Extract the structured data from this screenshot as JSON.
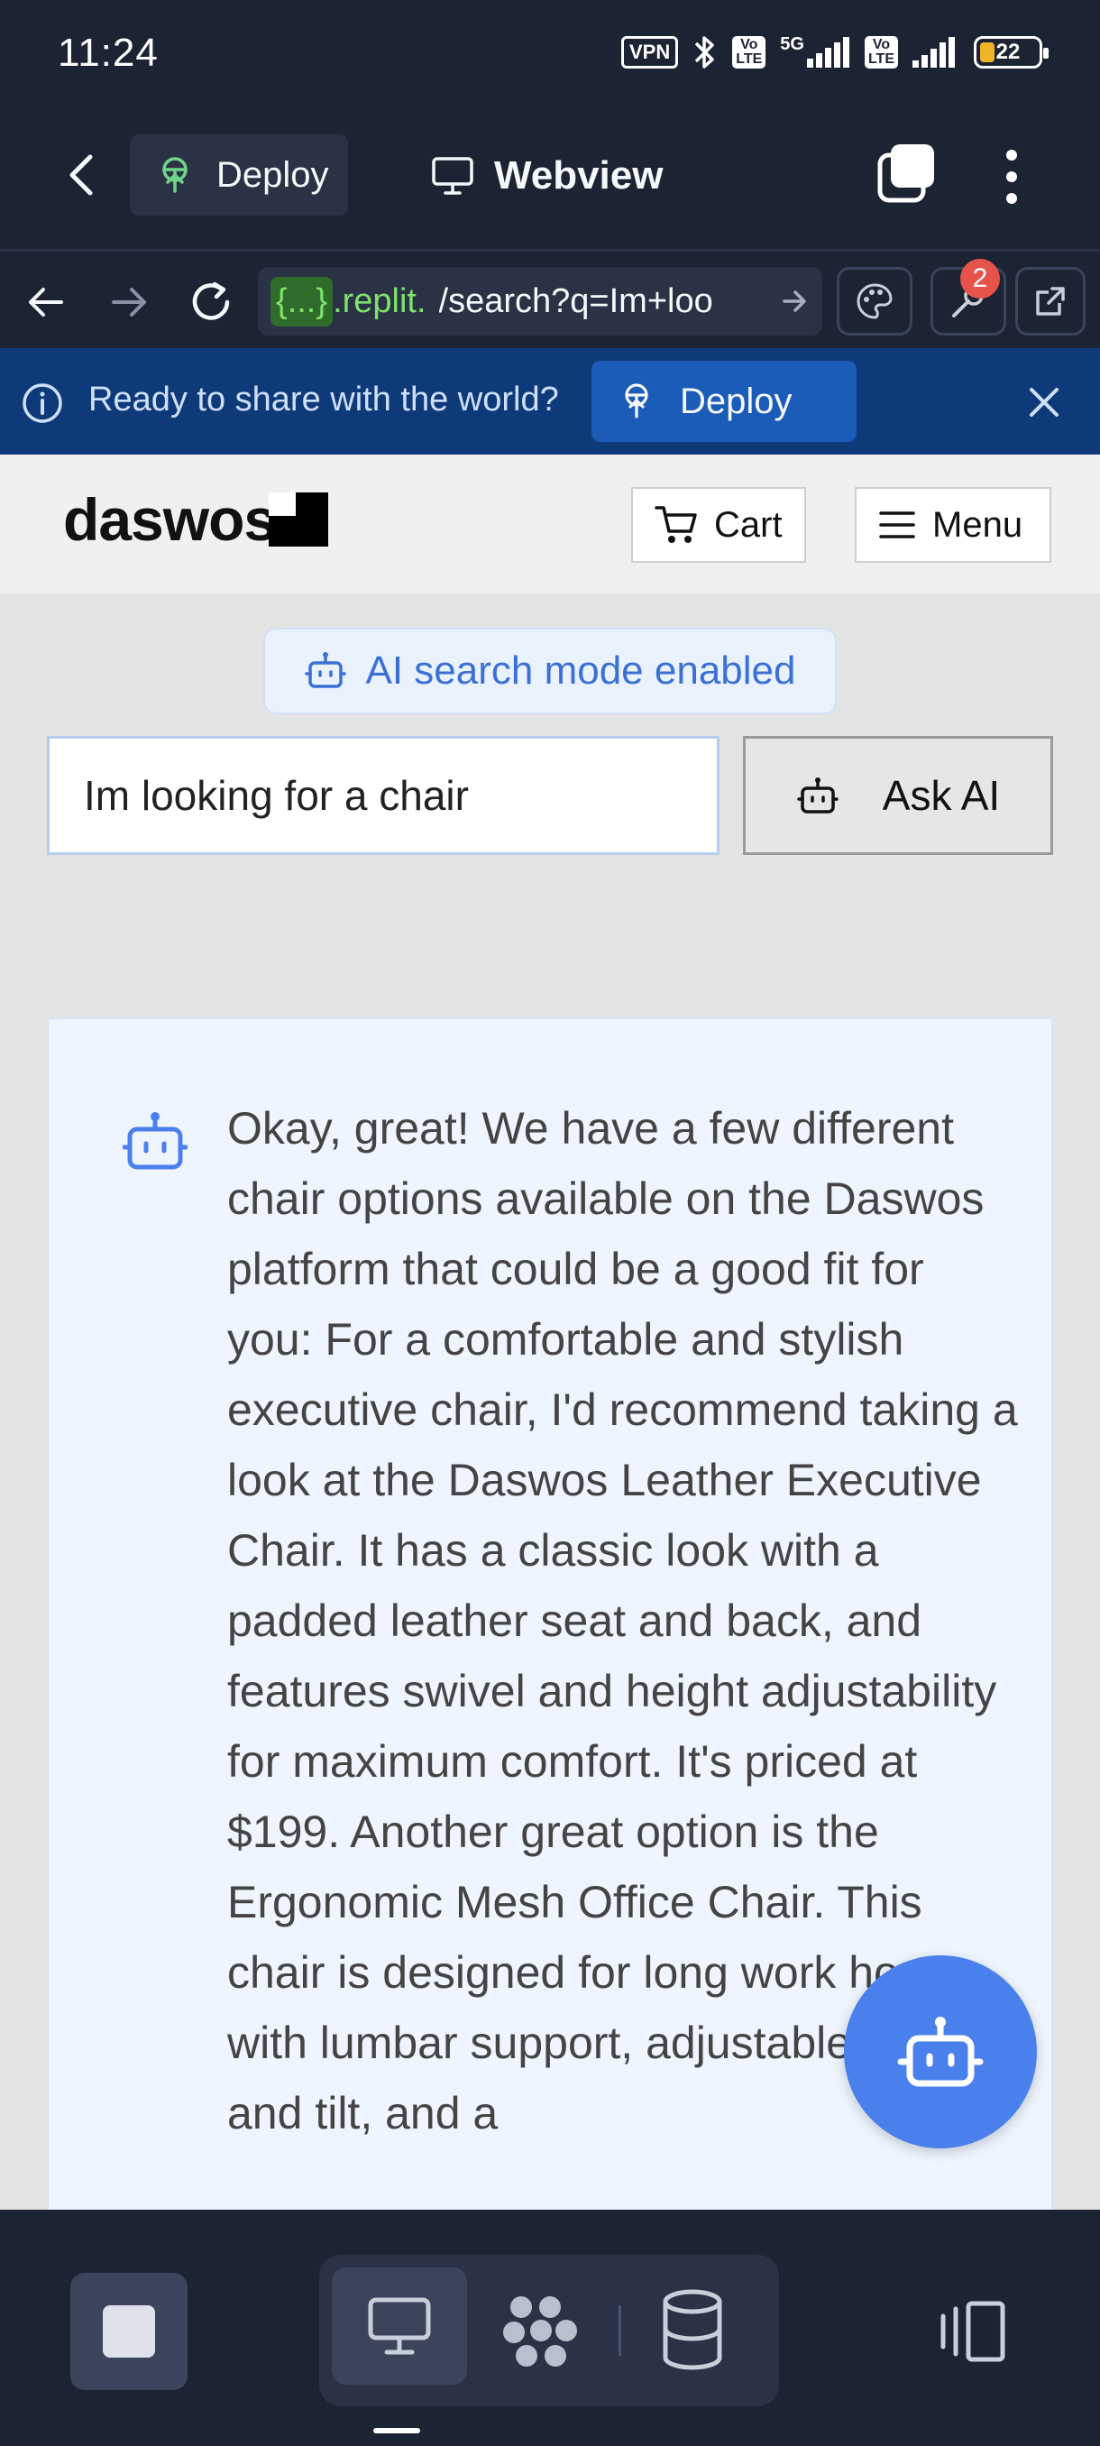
{
  "status_bar": {
    "time": "11:24",
    "vpn_label": "VPN",
    "signal_1": {
      "top": "Vo",
      "bottom": "LTE",
      "tech": "5G"
    },
    "signal_2": {
      "top": "Vo",
      "bottom": "LTE"
    },
    "battery_level": "22",
    "battery_color": "#f0b429"
  },
  "app_bar": {
    "deploy_label": "Deploy",
    "webview_title": "Webview"
  },
  "browser": {
    "url_host": "{...}",
    "url_host_rest": ".replit.",
    "url_path": "/search?q=Im+loo",
    "notification_count": "2"
  },
  "banner": {
    "text": "Ready to share with the world?",
    "deploy_label": "Deploy"
  },
  "site": {
    "logo_text": "daswos",
    "cart_label": "Cart",
    "menu_label": "Menu",
    "ai_mode_label": "AI search mode enabled",
    "search_value": "Im looking for a chair",
    "ask_ai_label": "Ask AI",
    "ai_response": "Okay, great! We have a few different chair options available on the Daswos platform that could be a good fit for you: For a comfortable and stylish executive chair, I'd recommend taking a look at the Daswos Leather Executive Chair. It has a classic look with a padded leather seat and back, and features swivel and height adjustability for maximum comfort. It's priced at $199. Another great option is the Ergonomic Mesh Office Chair. This chair is designed for long work hours, with lumbar support, adjustable height and tilt, and a"
  },
  "colors": {
    "ide_bg": "#1c2333",
    "banner_bg": "#0f3a7a",
    "accent_blue": "#4a80ec",
    "ai_text_blue": "#3b71d6",
    "badge_red": "#e5534b"
  },
  "icons": {
    "back": "chevron-left-icon",
    "deploy": "rocket-icon",
    "webview": "monitor-icon",
    "tabs": "tabs-icon",
    "more": "kebab-icon",
    "nav_back": "arrow-left-icon",
    "nav_forward": "arrow-right-icon",
    "reload": "reload-icon",
    "palette": "palette-icon",
    "devtools": "wrench-icon",
    "open_external": "external-link-icon",
    "info": "info-icon",
    "close": "close-icon",
    "cart": "cart-icon",
    "menu": "hamburger-icon",
    "bot": "robot-icon",
    "stop": "stop-icon",
    "workspace": "workspace-icon",
    "database": "database-icon",
    "panels": "panels-icon"
  }
}
